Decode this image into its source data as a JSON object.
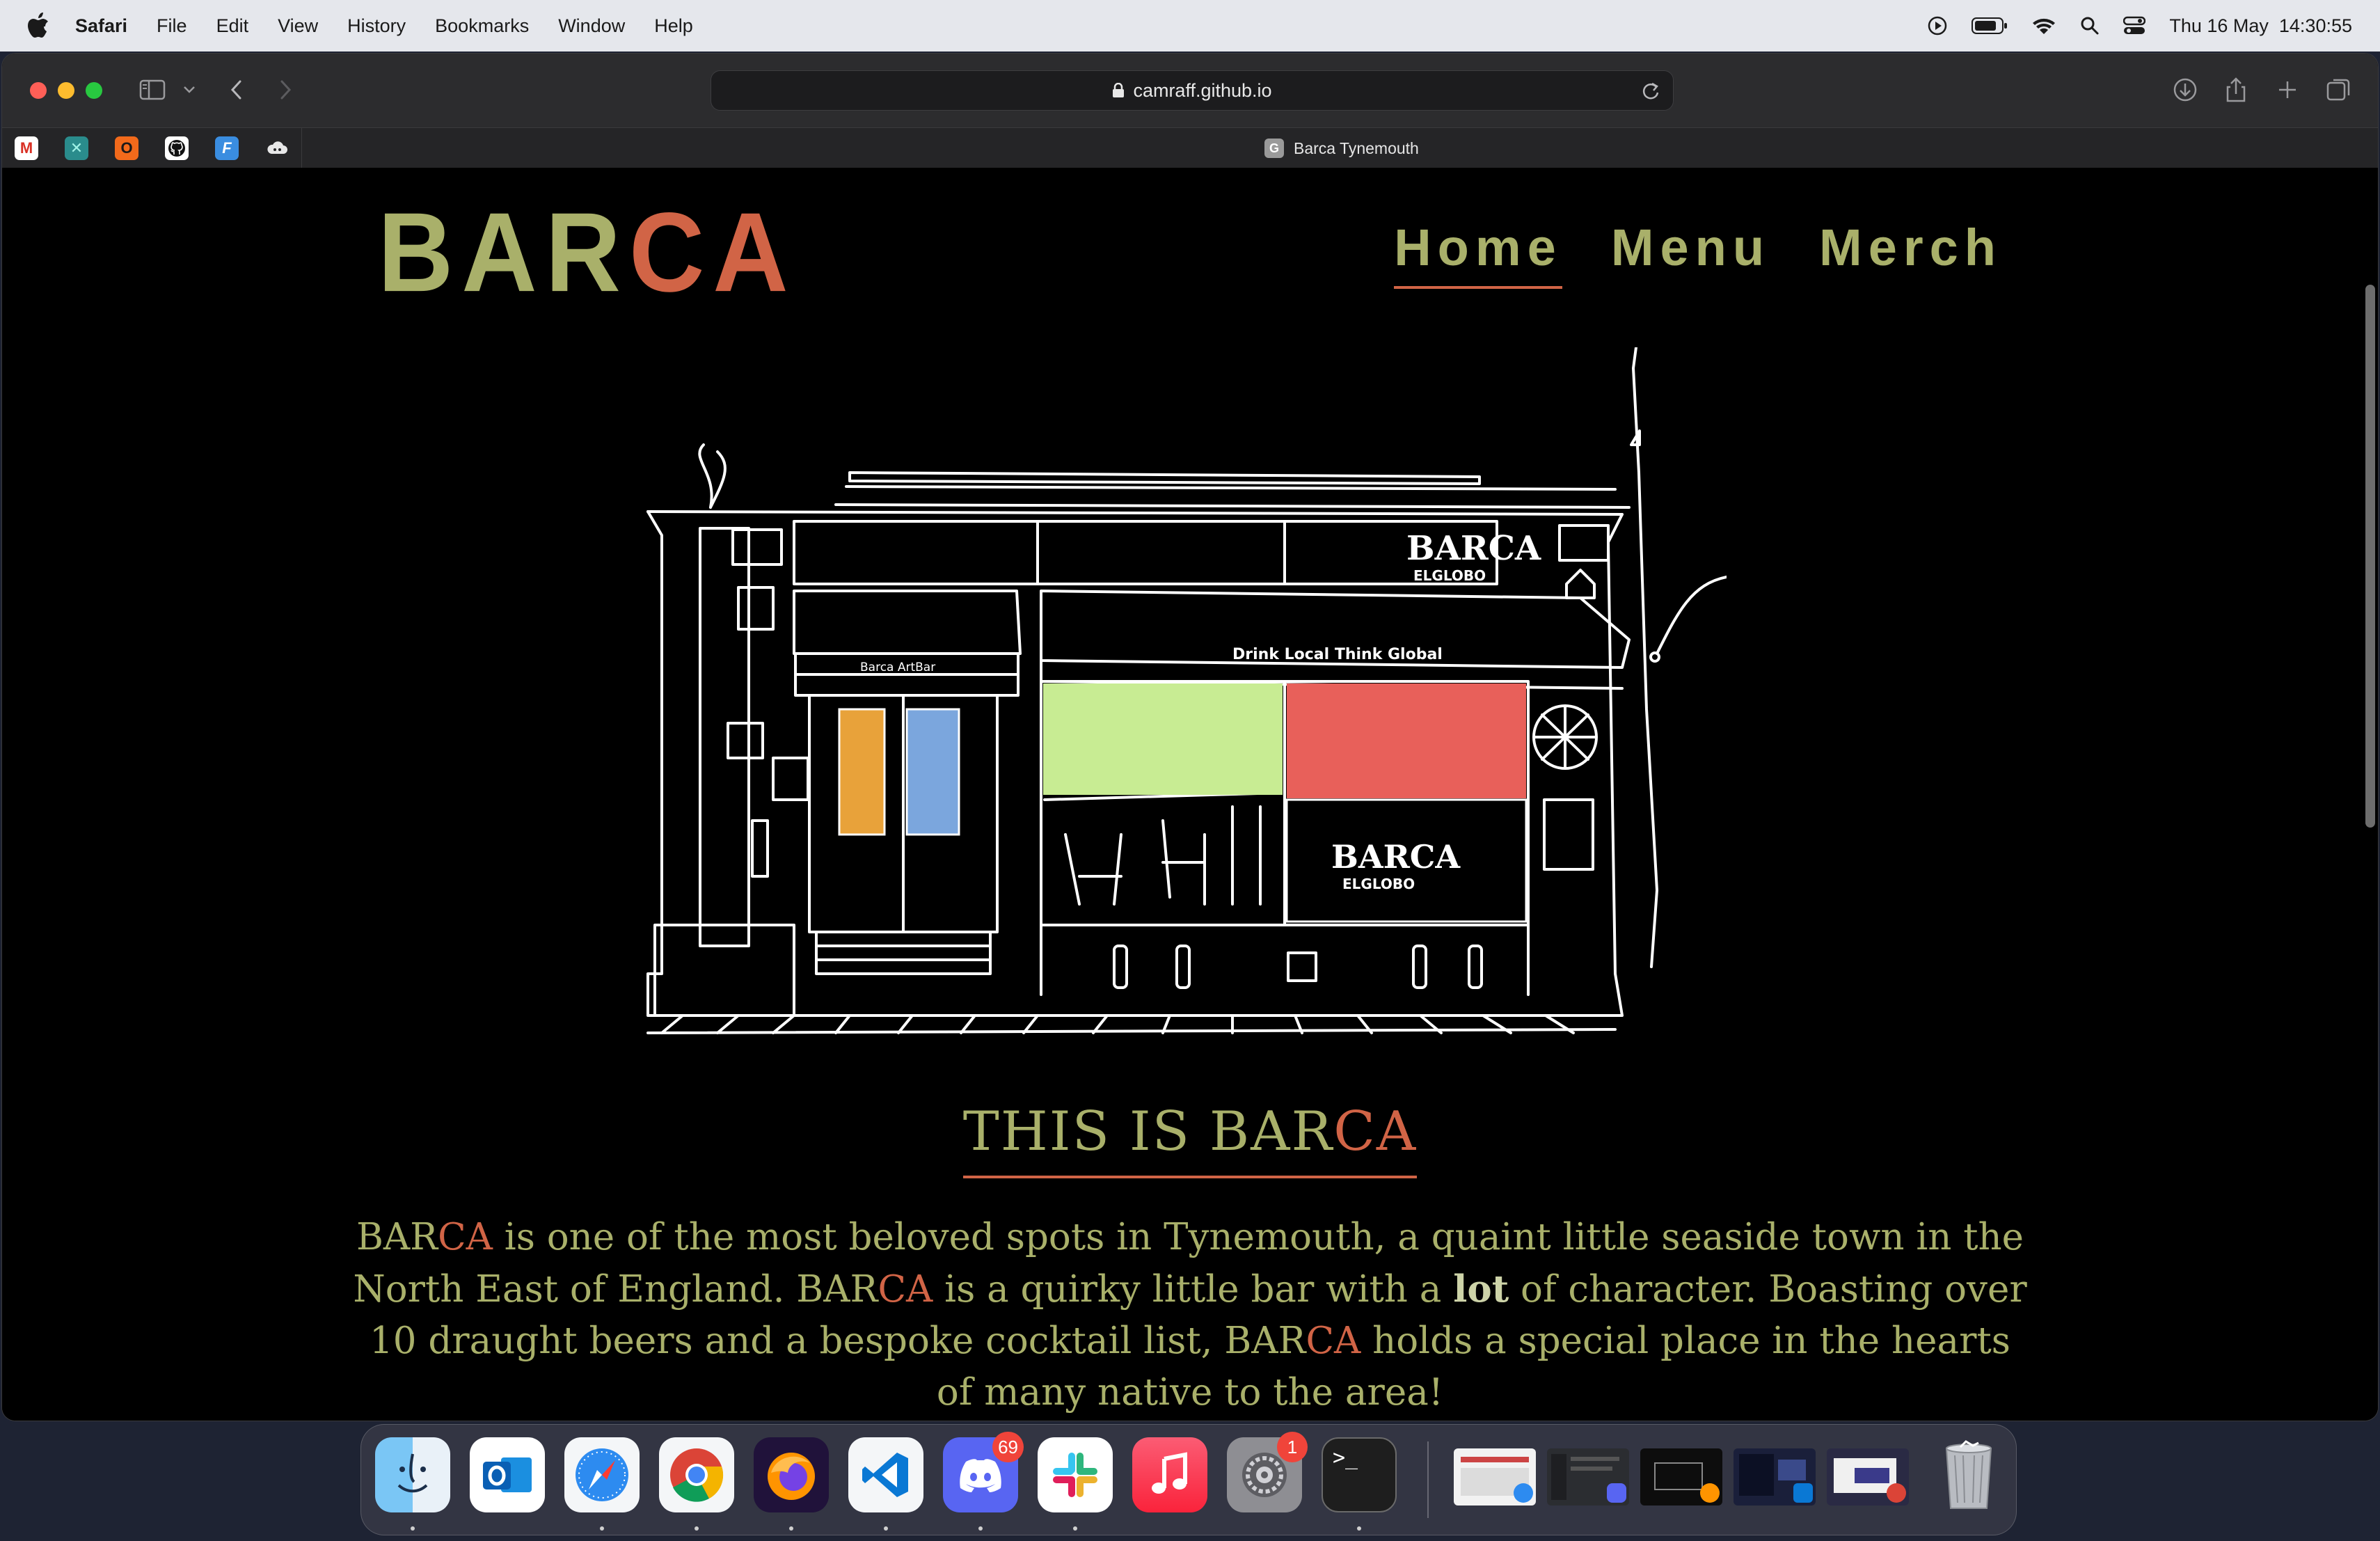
{
  "menubar": {
    "app_name": "Safari",
    "items": [
      "File",
      "Edit",
      "View",
      "History",
      "Bookmarks",
      "Window",
      "Help"
    ],
    "clock": "Thu 16 May  14:30:55"
  },
  "browser": {
    "url": "camraff.github.io",
    "active_tab_title": "Barca Tynemouth",
    "active_tab_favicon_letter": "G",
    "favorites": [
      {
        "icon": "gmail-icon",
        "letter": "M"
      },
      {
        "icon": "app-icon",
        "letter": "✕"
      },
      {
        "icon": "ring-icon",
        "letter": "O"
      },
      {
        "icon": "github-icon",
        "letter": ""
      },
      {
        "icon": "f-app-icon",
        "letter": "F"
      },
      {
        "icon": "cloud-icon",
        "letter": ""
      }
    ]
  },
  "site": {
    "logo_part1": "BAR",
    "logo_part2": "CA",
    "nav": [
      {
        "label": "Home",
        "active": true
      },
      {
        "label": "Menu",
        "active": false
      },
      {
        "label": "Merch",
        "active": false
      }
    ],
    "illustration_sign_text": "BARCA",
    "illustration_sign_subtext": "ELGLOBO",
    "illustration_awning_text": "Drink Local Think Global",
    "illustration_door_text": "Barca ArtBar",
    "heading_part1": "THIS IS BAR",
    "heading_part2": "CA",
    "intro": {
      "s1a": "BAR",
      "s1b": "CA",
      "s2": " is one of the most beloved spots in Tynemouth, a quaint little seaside town in the North East of England. ",
      "s3a": "BAR",
      "s3b": "CA",
      "s4": " is a quirky little bar with a ",
      "s5_bold": "lot",
      "s6": " of character. Boasting over 10 draught beers and a bespoke cocktail list, ",
      "s7a": "BAR",
      "s7b": "CA",
      "s8": " holds a special place in the hearts of many native to the area!"
    },
    "colors": {
      "green": "#a9b06a",
      "red": "#d16446",
      "window_green": "#c8ec93",
      "window_red": "#e8605a"
    }
  },
  "dock": {
    "apps": [
      "finder-icon",
      "outlook-icon",
      "safari-icon",
      "chrome-icon",
      "firefox-icon",
      "vscode-icon",
      "discord-icon",
      "slack-icon",
      "music-icon",
      "settings-icon",
      "terminal-icon"
    ],
    "discord_badge": "69",
    "settings_badge": "1",
    "terminal_prompt": ">_"
  }
}
